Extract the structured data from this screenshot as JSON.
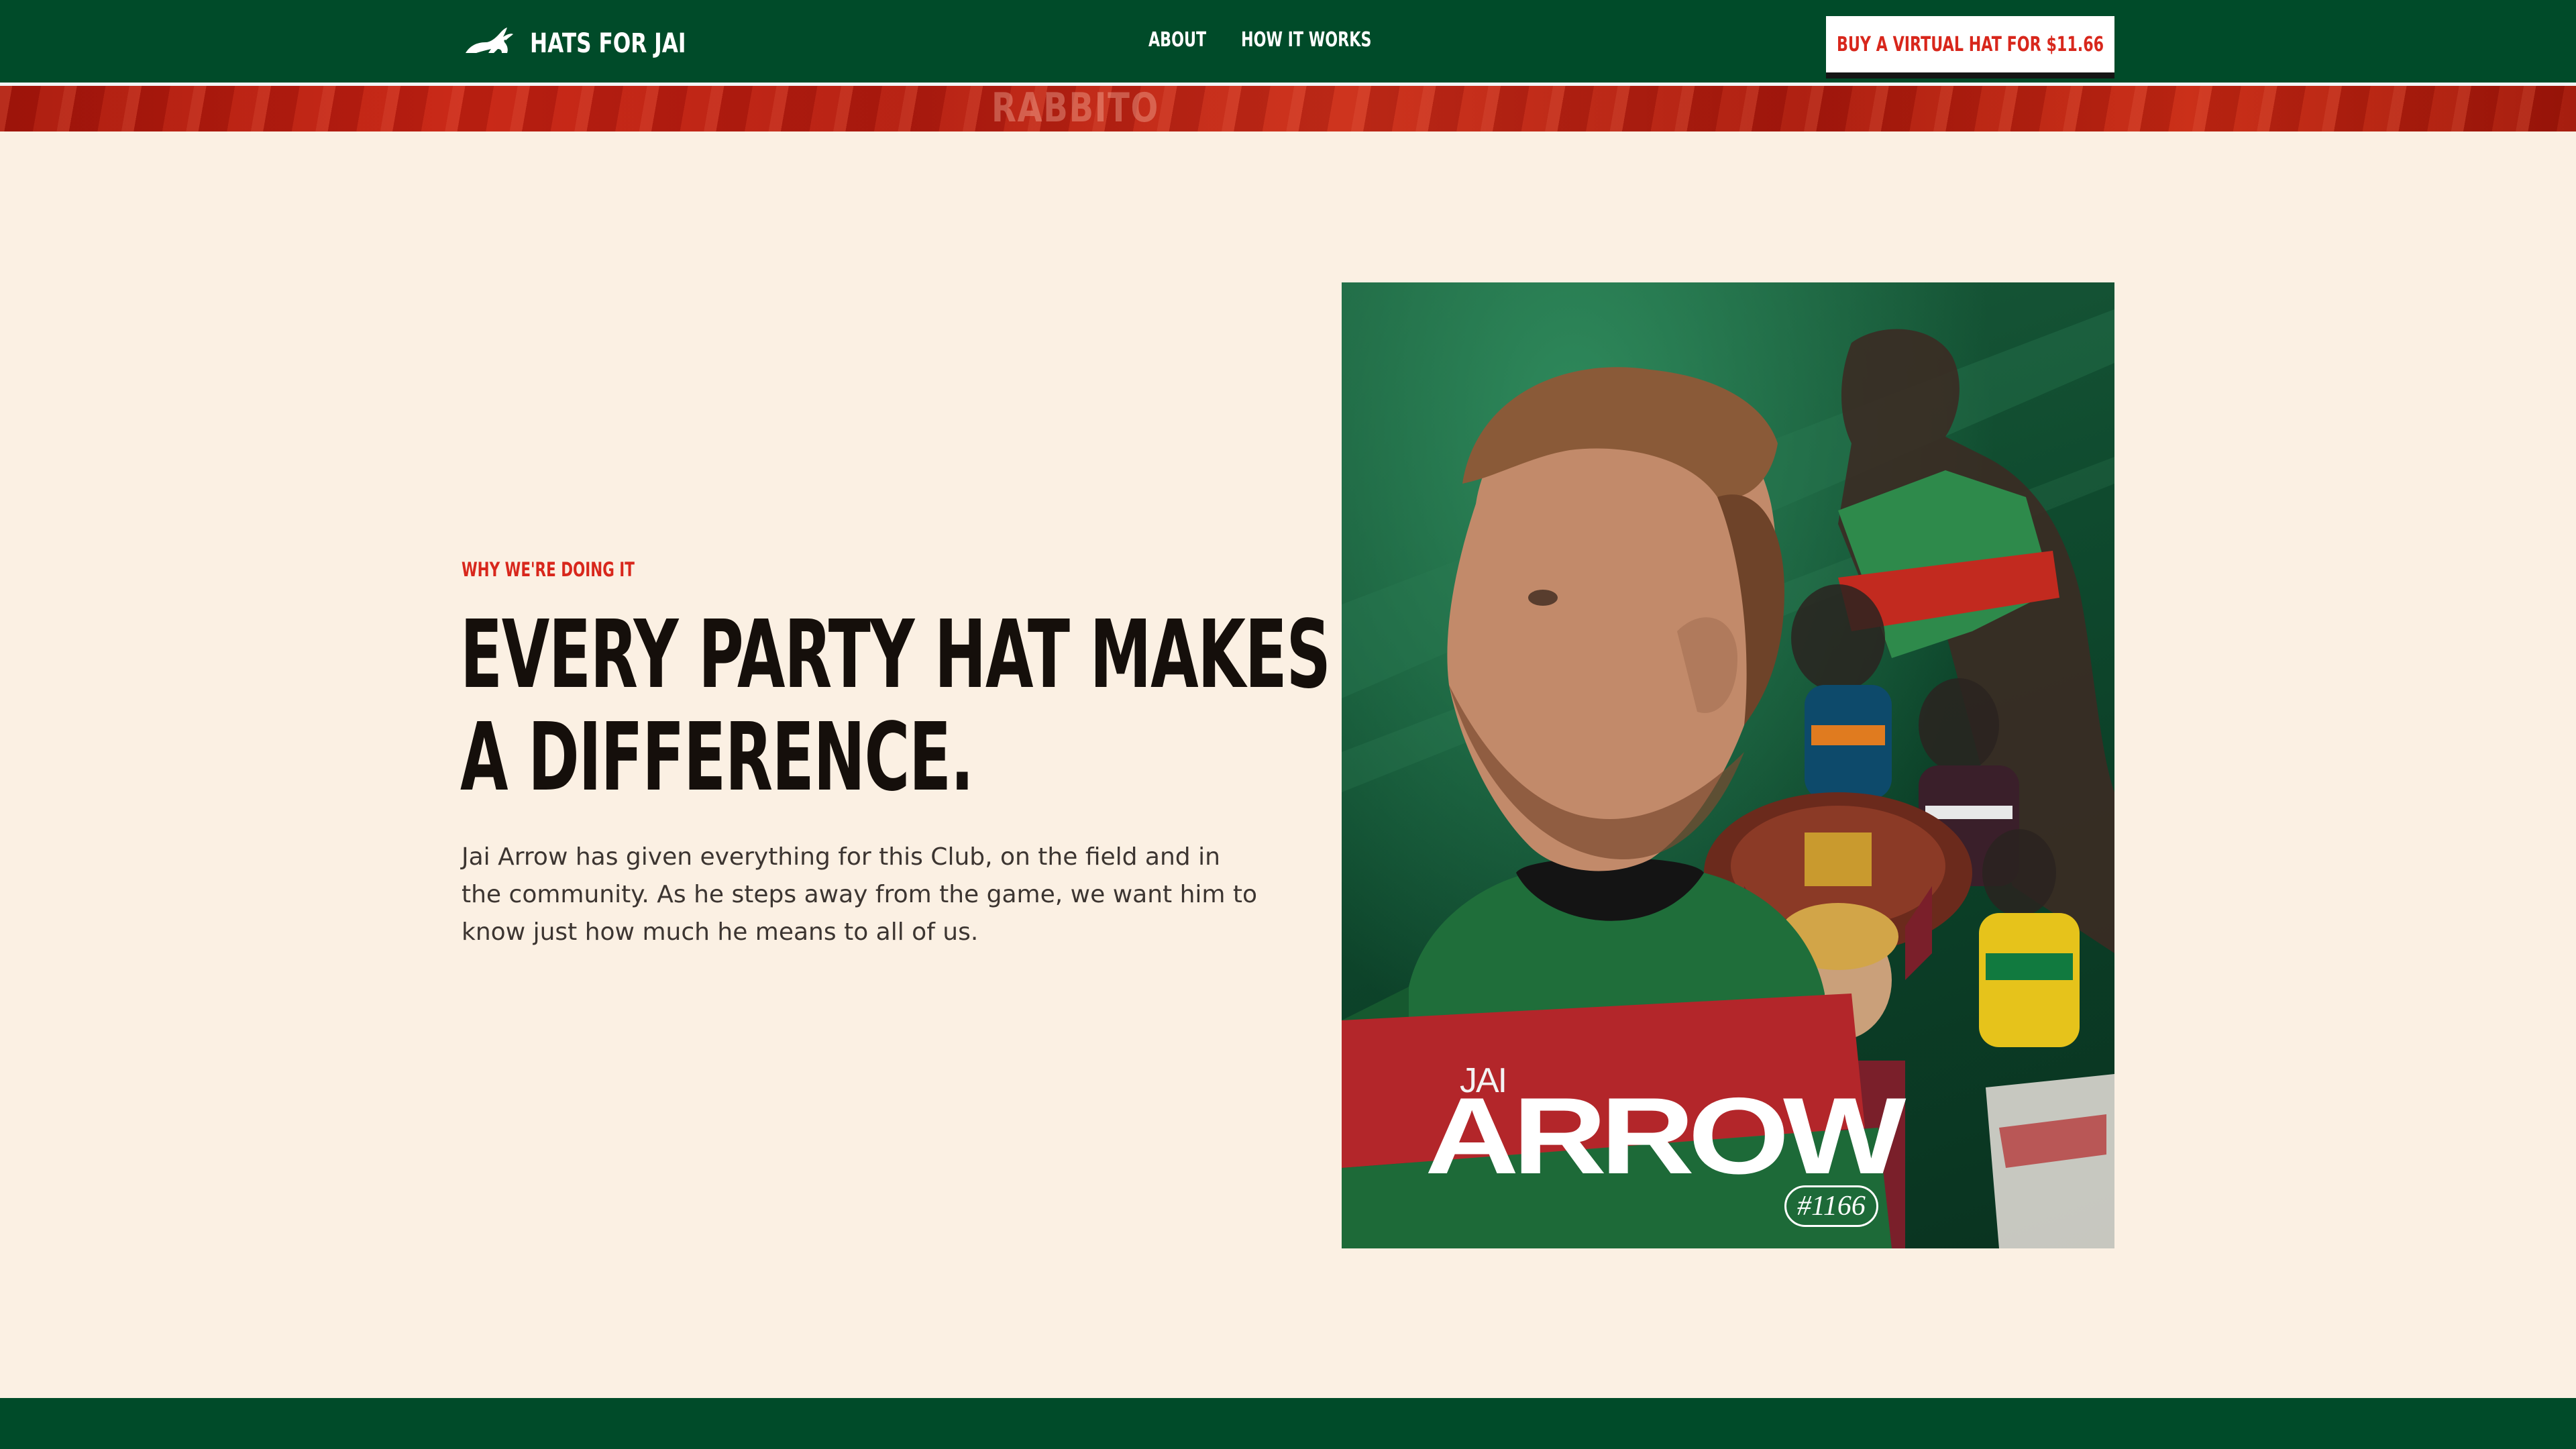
{
  "header": {
    "brand_title": "HATS FOR JAI",
    "logo_icon": "rabbit-icon",
    "nav": [
      {
        "label": "ABOUT"
      },
      {
        "label": "HOW IT WORKS"
      }
    ],
    "cta_label": "BUY A VIRTUAL HAT FOR $11.66"
  },
  "banner": {
    "text": "RABBITO"
  },
  "main": {
    "eyebrow": "WHY WE'RE DOING IT",
    "headline_line1": "EVERY PARTY HAT MAKES",
    "headline_line2": "A DIFFERENCE.",
    "body": "Jai Arrow has given everything for this Club, on the field and in the community. As he steps away from the game, we want him to know just how much he means to all of us."
  },
  "poster": {
    "first_name": "JAI",
    "last_name": "ARROW",
    "number": "#1166"
  },
  "colors": {
    "primary_green": "#004b29",
    "accent_red": "#d8271c",
    "background_cream": "#fbf0e3",
    "text_dark": "#150f0b"
  }
}
